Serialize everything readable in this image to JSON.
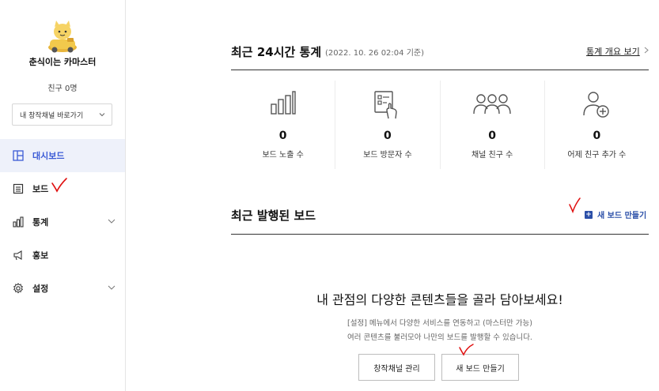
{
  "profile": {
    "name": "춘식이는 카마스터",
    "friends": "친구 0명",
    "channel_select": "내 창작채널 바로가기"
  },
  "nav": {
    "items": [
      {
        "label": "대시보드",
        "icon": "dashboard-icon",
        "active": true
      },
      {
        "label": "보드",
        "icon": "board-icon"
      },
      {
        "label": "통계",
        "icon": "chart-icon",
        "expandable": true
      },
      {
        "label": "홍보",
        "icon": "megaphone-icon"
      },
      {
        "label": "설정",
        "icon": "gear-icon",
        "expandable": true
      }
    ]
  },
  "stats": {
    "title": "최근 24시간 통계",
    "subtitle": "(2022. 10. 26 02:04 기준)",
    "overview_link": "통계 개요 보기",
    "cards": [
      {
        "value": "0",
        "label": "보드 노출 수",
        "icon": "bar-chart-icon"
      },
      {
        "value": "0",
        "label": "보드 방문자 수",
        "icon": "board-touch-icon"
      },
      {
        "value": "0",
        "label": "채널 친구 수",
        "icon": "users-icon"
      },
      {
        "value": "0",
        "label": "어제 친구 추가 수",
        "icon": "user-add-icon"
      }
    ]
  },
  "boards": {
    "title": "최근 발행된 보드",
    "new_board_link": "새 보드 만들기",
    "empty_title": "내 관점의 다양한 콘텐츠들을 골라 담아보세요!",
    "empty_desc_1": "[설정] 메뉴에서 다양한 서비스를 연동하고 (마스터만 가능)",
    "empty_desc_2": "여러 콘텐츠를 불러모아 나만의 보드를 발행할 수 있습니다.",
    "manage_button": "창작채널 관리",
    "new_button": "새 보드 만들기"
  },
  "colors": {
    "accent": "#3b5bd6",
    "link_blue": "#2b4fa8",
    "active_bg": "#eef1fa",
    "annotation_red": "#e01010"
  }
}
